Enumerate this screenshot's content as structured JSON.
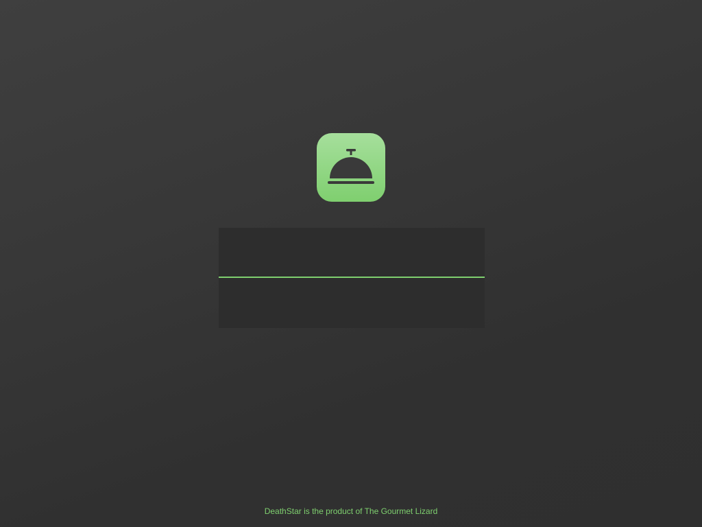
{
  "app": {
    "icon": "service-bell-icon",
    "accent_color": "#7fd06f",
    "icon_gradient": [
      "#a6df9c",
      "#7fcf6f"
    ]
  },
  "login": {
    "username_value": "",
    "password_value": ""
  },
  "footer": {
    "text": "DeathStar is the product of The Gourmet Lizard"
  }
}
